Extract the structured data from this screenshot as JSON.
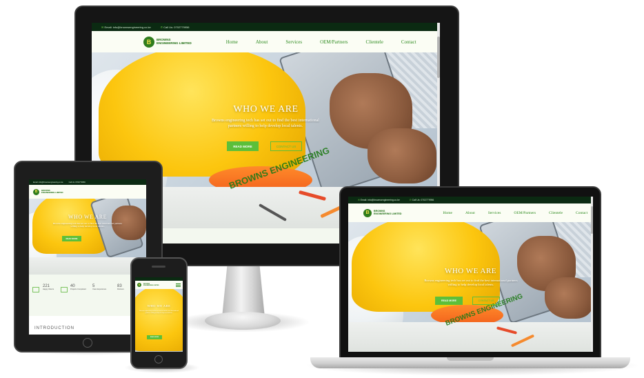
{
  "site": {
    "topbar": {
      "email": "Email: info@brownsengineering.co.ke",
      "phone": "Call Us: 0702779956"
    },
    "logo": {
      "mark": "B",
      "line1": "BROWNS",
      "line2": "ENGINEERING LIMITED"
    },
    "nav": [
      "Home",
      "About",
      "Services",
      "OEM/Partners",
      "Clientele",
      "Contact"
    ],
    "hero": {
      "title": "WHO WE ARE",
      "subtitle": "Browns engineering tech has set out to find the best international partners willing to help develop local talents.",
      "read_more": "READ MORE",
      "contact_us": "CONTACT US",
      "stamp": "BROWNS ENGINEERING"
    },
    "stats": [
      {
        "num": "221",
        "label": "Happy Clients"
      },
      {
        "num": "40",
        "label": "Projects Completed"
      },
      {
        "num": "5",
        "label": "Years Experience"
      },
      {
        "num": "83",
        "label": "Partners"
      }
    ],
    "intro_heading": "INTRODUCTION",
    "phone_menu_icon": "hamburger-icon"
  },
  "colors": {
    "brand_green": "#5cbf3a",
    "dark_green": "#0b2a12",
    "nav_text": "#2d8a1e",
    "helmet_yellow": "#fcc60f"
  }
}
